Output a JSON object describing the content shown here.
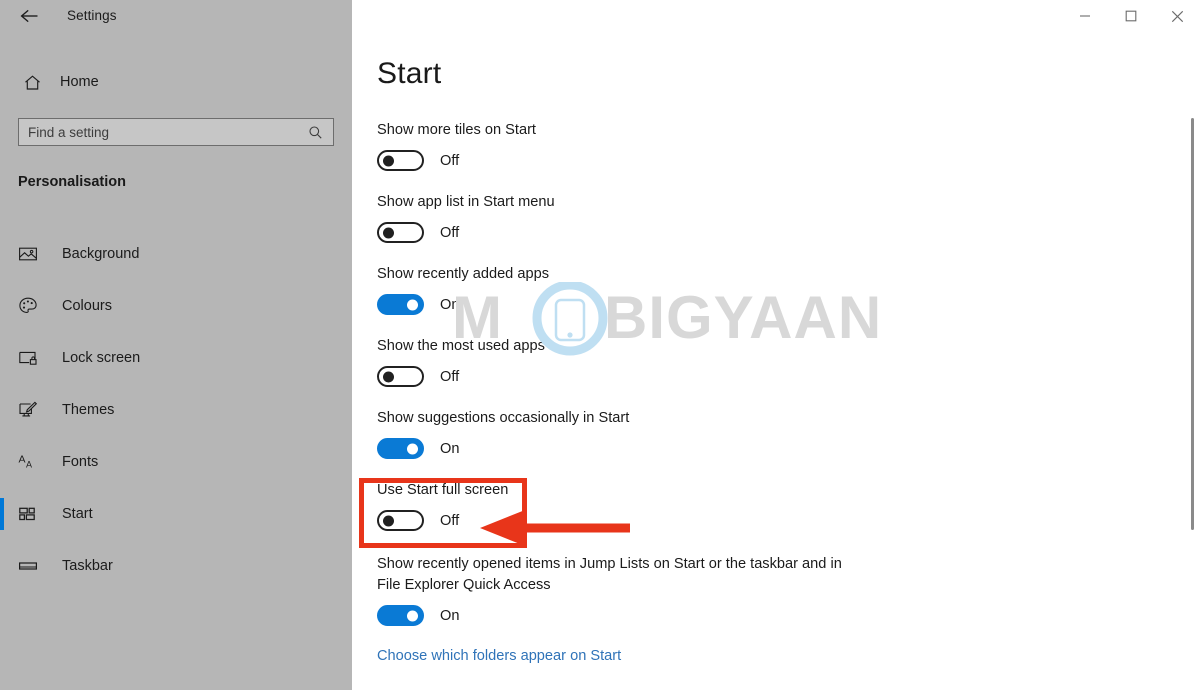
{
  "window": {
    "title": "Settings",
    "back_icon": "back-arrow-icon",
    "controls": {
      "minimize": "minimize-icon",
      "maximize": "maximize-icon",
      "close": "close-icon"
    }
  },
  "sidebar": {
    "home_label": "Home",
    "home_icon": "home-icon",
    "search": {
      "placeholder": "Find a setting",
      "value": "",
      "icon": "search-icon"
    },
    "section_heading": "Personalisation",
    "accent_color": "#0078d7",
    "background_color": "#b6b6b6",
    "items": [
      {
        "label": "Background",
        "icon": "picture-icon",
        "selected": false
      },
      {
        "label": "Colours",
        "icon": "palette-icon",
        "selected": false
      },
      {
        "label": "Lock screen",
        "icon": "lock-screen-icon",
        "selected": false
      },
      {
        "label": "Themes",
        "icon": "themes-icon",
        "selected": false
      },
      {
        "label": "Fonts",
        "icon": "fonts-icon",
        "selected": false
      },
      {
        "label": "Start",
        "icon": "start-tiles-icon",
        "selected": true
      },
      {
        "label": "Taskbar",
        "icon": "taskbar-icon",
        "selected": false
      }
    ]
  },
  "main": {
    "page_title": "Start",
    "settings": [
      {
        "label": "Show more tiles on Start",
        "state": "Off",
        "on": false
      },
      {
        "label": "Show app list in Start menu",
        "state": "Off",
        "on": false
      },
      {
        "label": "Show recently added apps",
        "state": "On",
        "on": true
      },
      {
        "label": "Show the most used apps",
        "state": "Off",
        "on": false
      },
      {
        "label": "Show suggestions occasionally in Start",
        "state": "On",
        "on": true
      },
      {
        "label": "Use Start full screen",
        "state": "Off",
        "on": false,
        "highlighted": true
      },
      {
        "label": "Show recently opened items in Jump Lists on Start or the taskbar and in File Explorer Quick Access",
        "state": "On",
        "on": true
      }
    ],
    "link_label": "Choose which folders appear on Start",
    "link_color": "#2f73b8",
    "toggle_on_color": "#0a7ad5"
  },
  "annotations": {
    "highlight_color": "#e8351a",
    "highlight_target": "Use Start full screen",
    "arrow_icon": "left-arrow-annotation-icon"
  },
  "watermark": {
    "text": "MOBIGYAAN",
    "text_color": "#d7d7d7",
    "logo_color": "#bfdff2"
  },
  "scrollbar": {
    "thumb_color": "#8a8a8a"
  }
}
